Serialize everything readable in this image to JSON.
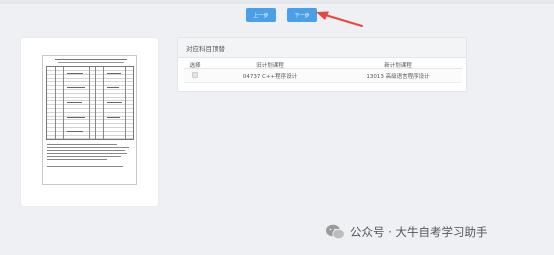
{
  "toolbar": {
    "prev_label": "上一步",
    "next_label": "下一步"
  },
  "panel": {
    "title": "对应科目顶替",
    "columns": [
      "选择",
      "旧计划课程",
      "新计划课程"
    ],
    "rows": [
      {
        "old_course": "04737 C++程序设计",
        "new_course": "13013 高级语言程序设计"
      }
    ]
  },
  "watermark": {
    "text": "公众号 · 大牛自考学习助手"
  },
  "colors": {
    "button": "#4a9fe8",
    "arrow": "#e8473f",
    "background": "#eef0f3"
  },
  "icons": [
    "arrow-annotation-icon",
    "wechat-icon",
    "checkbox-icon"
  ]
}
